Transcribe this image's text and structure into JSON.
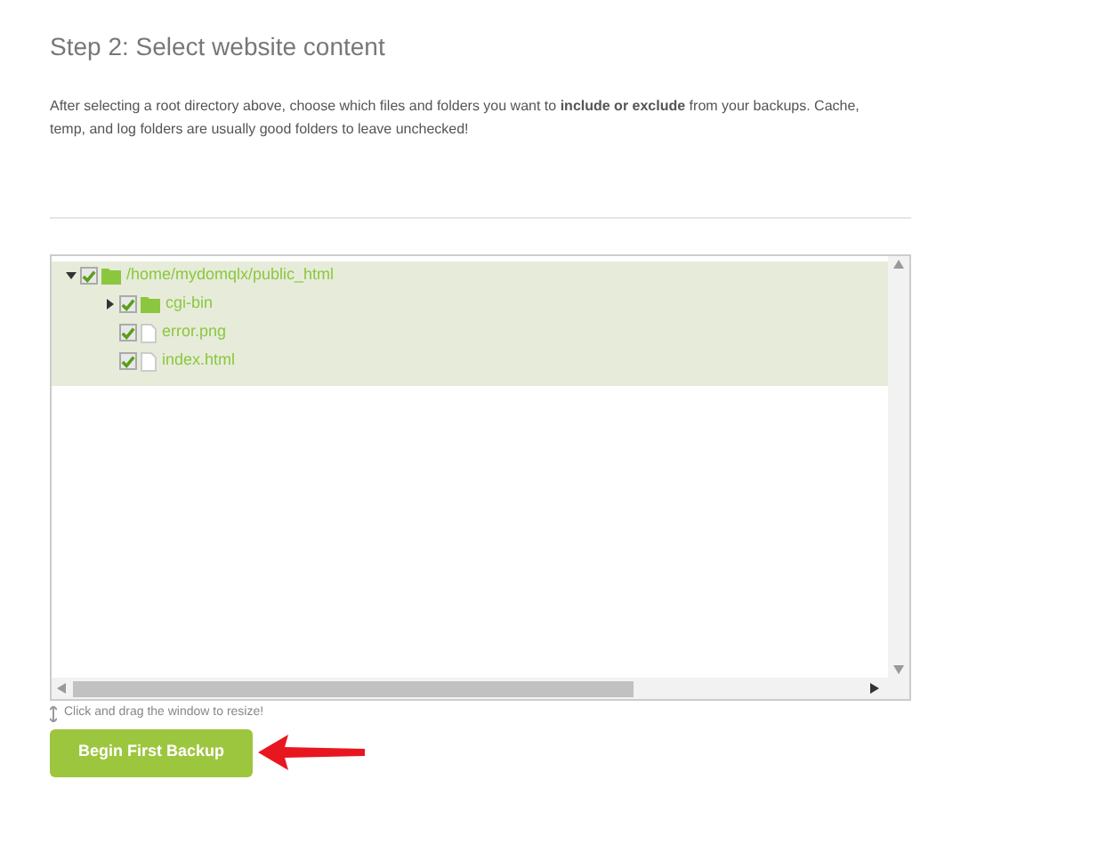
{
  "heading": "Step 2: Select website content",
  "intro": "After selecting a root directory above, choose which files and folders you want to **include or exclude** from your backups. Cache, temp, and log folders are usually good folders to leave unchecked!",
  "tree": [
    {
      "label": "/home/mydomqlx/public_html",
      "kind": "folder",
      "expanded": true,
      "checked": true,
      "children": [
        {
          "label": "cgi-bin",
          "kind": "folder",
          "expanded": false,
          "checked": true
        },
        {
          "label": "error.png",
          "kind": "file",
          "checked": true
        },
        {
          "label": "index.html",
          "kind": "file",
          "checked": true
        }
      ]
    }
  ],
  "resize_hint": "Click and drag the window to resize!",
  "button": "Begin First Backup"
}
